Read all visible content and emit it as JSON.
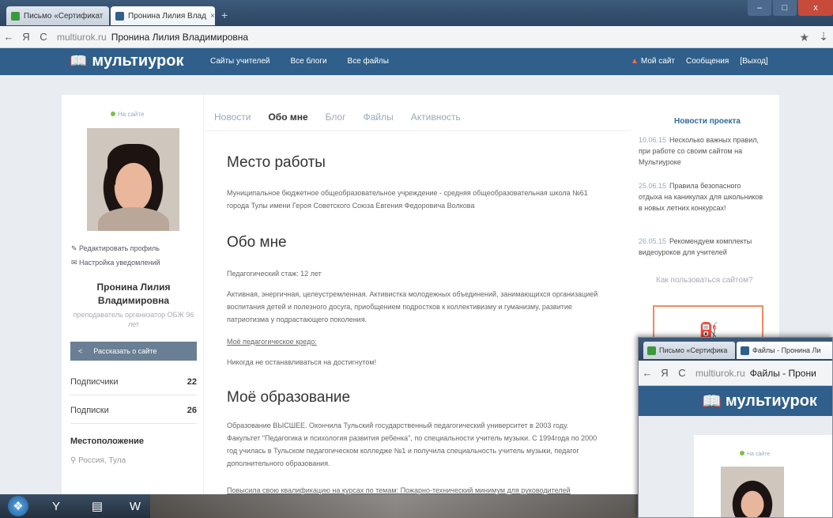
{
  "browser": {
    "tabs": [
      {
        "label": "Письмо «Сертификат",
        "color": "#3a9a3a"
      },
      {
        "label": "Пронина Лилия Влад",
        "color": "#2f5f8a"
      }
    ],
    "tab_close": "×",
    "new_tab": "+",
    "address": {
      "back": "←",
      "yandex": "Я",
      "reload": "C",
      "domain": "multiurok.ru",
      "title": "Пронина Лилия Владимировна"
    },
    "star": "★",
    "download": "⇣",
    "window_buttons": {
      "minimize": "–",
      "maximize": "□",
      "close": "x"
    }
  },
  "site": {
    "logo": "мультиурок",
    "logo_icon": "book-icon",
    "nav": [
      "Сайты учителей",
      "Все блоги",
      "Все файлы"
    ],
    "user_nav": {
      "my_site": "Мой сайт",
      "messages": "Сообщения",
      "logout": "[Выход]"
    }
  },
  "profile": {
    "online": "На сайте",
    "edit_link": "Редактировать профиль",
    "notify_link": "Настройка уведомлений",
    "name": "Пронина Лилия Владимировна",
    "role": "преподаватель организатор ОБЖ 96 лет",
    "share": "Рассказать о сайте",
    "stats": [
      {
        "label": "Подписчики",
        "value": "22"
      },
      {
        "label": "Подписки",
        "value": "26"
      }
    ],
    "location_title": "Местоположение",
    "location_value": "Россия, Тула"
  },
  "main": {
    "tabs": [
      "Новости",
      "Обо мне",
      "Блог",
      "Файлы",
      "Активность"
    ],
    "active_tab": "Обо мне",
    "sections": {
      "work_title": "Место работы",
      "work_text": "Муниципальное бюджетное общеобразовательное учреждение - средняя общеобразовательная школа №61 города Тулы имени Героя Советского Союза Евгения Федоровича Волкова",
      "about_title": "Обо мне",
      "about_stage": "Педагогический стаж: 12 лет",
      "about_text": "Активная, энергичная, целеустремленная. Активистка молодежных объединений, занимающихся организацией воспитания детей и полезного досуга, приобщением подростков к коллективизму и гуманизму, развитие патриотизма у подрастающего поколения.",
      "credo_link": "Моё педагогическое кредо:",
      "credo_text": "Никогда не останавливаться на достигнутом!",
      "edu_title": "Моё образование",
      "edu_text": "Образование ВЫСШЕЕ. Окончила Тульский государственный педагогический университет в 2003 году. Факультет \"Педагогика и психология развития ребенка\", по специальности учитель музыки. С 1994года по 2000 год училась в Тульском педагогическом колледже №1 и получила специальность учитель музыки, педагог дополнительного образования.",
      "courses_text": "Повысила свою квалификацию на курсах по темам: Пожарно-технический минимум для руководителей"
    }
  },
  "news": {
    "title": "Новости проекта",
    "items": [
      {
        "date": "10.06.15",
        "text": "Несколько важных правил, при работе со своим сайтом на Мультиуроке"
      },
      {
        "date": "25.06.15",
        "text": "Правила безопасного отдыха на каникулах для школьников в новых летних конкурсах!"
      },
      {
        "date": "26.05.15",
        "text": "Рекомендуем комплекты видеоуроков для учителей"
      }
    ],
    "howto": "Как пользоваться сайтом?"
  },
  "window2": {
    "tabs": [
      "Письмо «Сертифика",
      "Файлы - Пронина Ли"
    ],
    "address": {
      "back": "←",
      "yandex": "Я",
      "reload": "C",
      "domain": "multiurok.ru",
      "title": "Файлы - Прони"
    },
    "logo": "мультиурок",
    "online": "На сайте"
  },
  "taskbar": {
    "items": [
      "windows-start-icon",
      "yandex-browser-icon",
      "file-explorer-icon",
      "word-icon"
    ]
  },
  "colors": {
    "header": "#2f5f8a",
    "accent": "#f08a60",
    "link": "#2f6a99"
  }
}
